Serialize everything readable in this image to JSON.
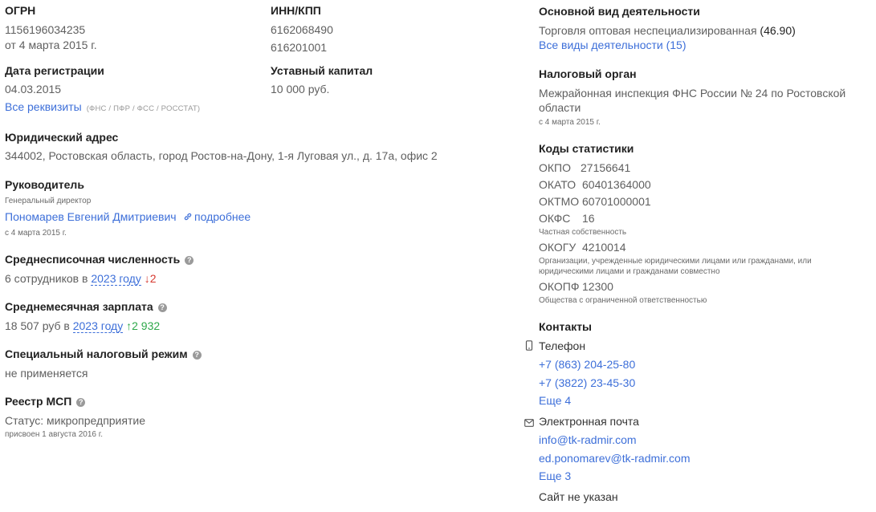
{
  "ogrn": {
    "label": "ОГРН",
    "value": "1156196034235",
    "date": "от 4 марта 2015 г."
  },
  "inn_kpp": {
    "label": "ИНН/КПП",
    "inn": "6162068490",
    "kpp": "616201001"
  },
  "reg_date": {
    "label": "Дата регистрации",
    "value": "04.03.2015"
  },
  "capital": {
    "label": "Уставный капитал",
    "value": "10 000 руб."
  },
  "requisites": {
    "link": "Все реквизиты",
    "note": "(ФНС / ПФР / ФСС / РОССТАТ)"
  },
  "address": {
    "label": "Юридический адрес",
    "value": "344002, Ростовская область, город Ростов-на-Дону, 1-я Луговая ул., д. 17а, офис 2"
  },
  "director": {
    "label": "Руководитель",
    "role": "Генеральный директор",
    "name": "Пономарев Евгений Дмитриевич",
    "more": "подробнее",
    "date": "с 4 марта 2015 г."
  },
  "employees": {
    "label": "Среднесписочная численность",
    "prefix": "6 сотрудников в",
    "year": "2023 году",
    "delta": "↓2"
  },
  "salary": {
    "label": "Среднемесячная зарплата",
    "prefix": "18 507 руб в",
    "year": "2023 году",
    "delta": "↑2 932"
  },
  "tax_regime": {
    "label": "Специальный налоговый режим",
    "value": "не применяется"
  },
  "msp": {
    "label": "Реестр МСП",
    "status": "Статус: микропредприятие",
    "date": "присвоен 1 августа 2016 г."
  },
  "activity": {
    "label": "Основной вид деятельности",
    "value": "Торговля оптовая неспециализированная",
    "code": "(46.90)",
    "all_link": "Все виды деятельности (15)"
  },
  "tax_office": {
    "label": "Налоговый орган",
    "line1": "Межрайонная инспекция ФНС России № 24 по Ростовской",
    "line2": "области",
    "date": "с 4 марта 2015 г."
  },
  "stats": {
    "label": "Коды статистики",
    "okpo": {
      "k": "ОКПО",
      "v": "27156641"
    },
    "okato": {
      "k": "ОКАТО",
      "v": "60401364000"
    },
    "oktmo": {
      "k": "ОКТМО",
      "v": "60701000001"
    },
    "okfs": {
      "k": "ОКФС",
      "v": "16",
      "desc": "Частная собственность"
    },
    "okogu": {
      "k": "ОКОГУ",
      "v": "4210014",
      "desc1": "Организации, учрежденные юридическими лицами или гражданами, или",
      "desc2": "юридическими лицами и гражданами совместно"
    },
    "okopf": {
      "k": "ОКОПФ",
      "v": "12300",
      "desc": "Общества с ограниченной ответственностью"
    }
  },
  "contacts": {
    "label": "Контакты",
    "phone_label": "Телефон",
    "phone1": "+7 (863) 204-25-80",
    "phone2": "+7 (3822) 23-45-30",
    "phone_more": "Еще 4",
    "email_label": "Электронная почта",
    "email1": "info@tk-radmir.com",
    "email2": "ed.ponomarev@tk-radmir.com",
    "email_more": "Еще 3",
    "site": "Сайт не указан"
  },
  "icons": {
    "help": "help-circle-icon",
    "link": "link-icon",
    "phone": "phone-icon",
    "mail": "mail-icon"
  },
  "colors": {
    "link": "#3d6fd9",
    "down": "#d6382e",
    "up": "#2ea84a"
  }
}
